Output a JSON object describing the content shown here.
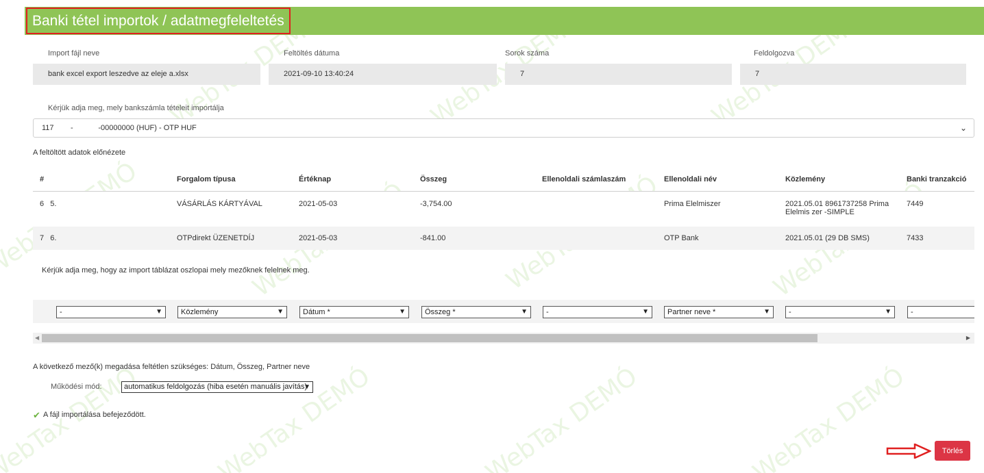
{
  "page": {
    "title": "Banki tétel importok / adatmegfeleltetés",
    "watermark_text": "WebTax DEMÓ"
  },
  "import_info": {
    "file_label": "Import fájl neve",
    "file_value": "bank excel export leszedve az eleje a.xlsx",
    "date_label": "Feltöltés dátuma",
    "date_value": "2021-09-10 13:40:24",
    "rows_label": "Sorok száma",
    "rows_value": "7",
    "processed_label": "Feldolgozva",
    "processed_value": "7"
  },
  "account": {
    "prompt": "Kérjük adja meg, mely bankszámla tételeit importálja",
    "selected": "117        -            -00000000 (HUF) - OTP HUF"
  },
  "preview": {
    "title": "A feltöltött adatok előnézete",
    "columns": [
      "#",
      "Forgalom típusa",
      "Értéknap",
      "Összeg",
      "Ellenoldali számlaszám",
      "Ellenoldali név",
      "Közlemény",
      "Banki tranzakció"
    ],
    "rows": [
      {
        "idx": "6",
        "num": "5.",
        "type": "VÁSÁRLÁS KÁRTYÁVAL",
        "date": "2021-05-03",
        "amount": "-3,754.00",
        "account": "",
        "name": "Prima Elelmiszer",
        "note": "2021.05.01 8961737258 Prima Elelmis zer -SIMPLE",
        "tx": "7449"
      },
      {
        "idx": "7",
        "num": "6.",
        "type": "OTPdirekt ÜZENETDÍJ",
        "date": "2021-05-03",
        "amount": "-841.00",
        "account": "",
        "name": "OTP Bank",
        "note": "2021.05.01 (29 DB SMS)",
        "tx": "7433"
      }
    ]
  },
  "mapping": {
    "prompt": "Kérjük adja meg, hogy az import táblázat oszlopai mely mezőknek felelnek meg.",
    "selects": [
      "-",
      "Közlemény",
      "Dátum *",
      "Összeg *",
      "-",
      "Partner neve *",
      "-",
      "-"
    ]
  },
  "requirements": {
    "text": "A következő mező(k) megadása feltétlen szükséges: Dátum, Összeg, Partner neve"
  },
  "mode": {
    "label": "Működési mód:",
    "selected": "automatikus feldolgozás (hiba esetén manuális javítás)"
  },
  "status": {
    "text": "A fájl importálása befejeződött.",
    "color": "#6cb33f"
  },
  "actions": {
    "delete_label": "Törlés",
    "delete_color": "#dc3545"
  },
  "theme": {
    "header_color": "#8fc456",
    "highlight_color": "#e02020"
  }
}
